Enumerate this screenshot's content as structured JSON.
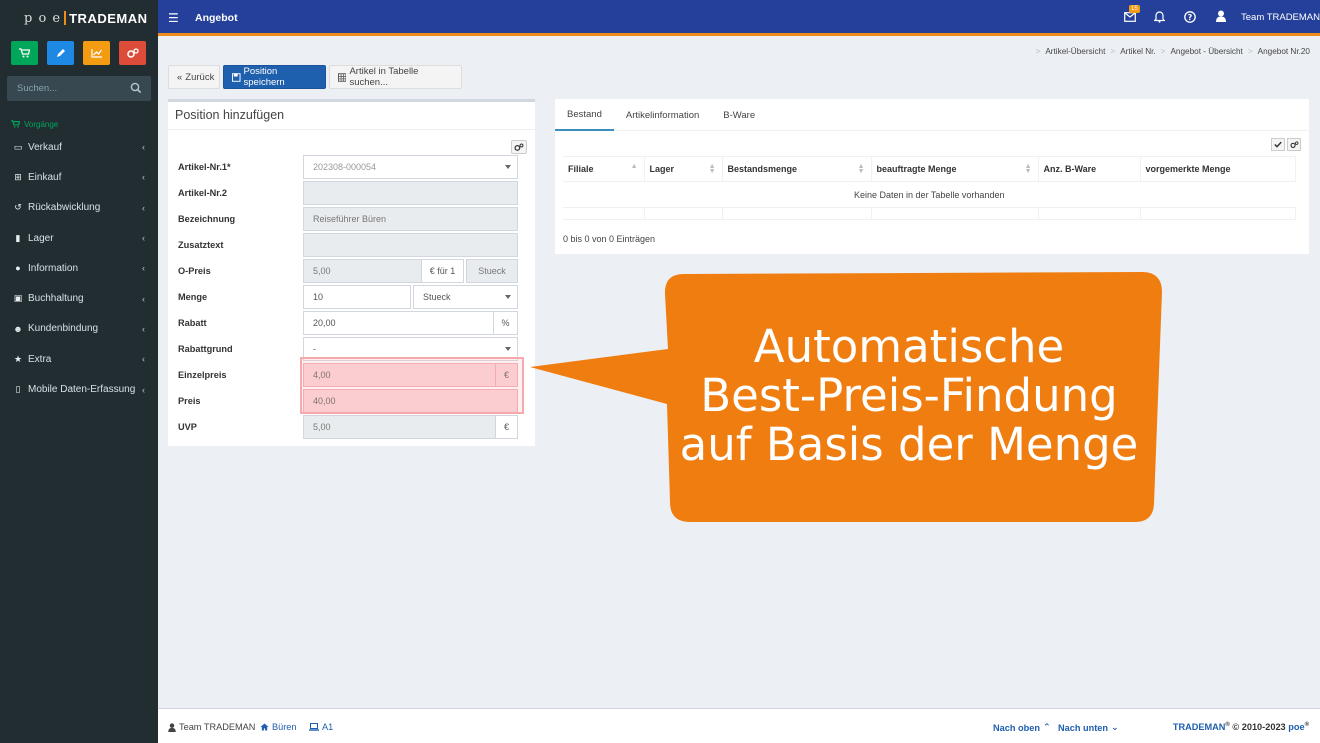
{
  "app": {
    "logo_prefix": "p o e",
    "logo_brand": "TRADEMAN",
    "page_title": "Angebot",
    "mail_count": "15",
    "user": "Team TRADEMAN"
  },
  "sidebar": {
    "search_placeholder": "Suchen...",
    "section": "Vorgänge",
    "items": [
      {
        "label": "Verkauf",
        "icon": "desktop-icon"
      },
      {
        "label": "Einkauf",
        "icon": "cart-icon"
      },
      {
        "label": "Rückabwicklung",
        "icon": "undo-icon"
      },
      {
        "label": "Lager",
        "icon": "truck-icon"
      },
      {
        "label": "Information",
        "icon": "info-icon"
      },
      {
        "label": "Buchhaltung",
        "icon": "money-icon"
      },
      {
        "label": "Kundenbindung",
        "icon": "users-icon"
      },
      {
        "label": "Extra",
        "icon": "star-icon"
      },
      {
        "label": "Mobile Daten-Erfassung",
        "icon": "mobile-icon"
      }
    ],
    "quick_colors": [
      "#00a65a",
      "#1e88e5",
      "#f39c12",
      "#dd4b39"
    ]
  },
  "breadcrumb": [
    "Artikel-Übersicht",
    "Artikel Nr.",
    "Angebot - Übersicht",
    "Angebot Nr.20"
  ],
  "toolbar": {
    "back": "Zurück",
    "save": "Position speichern",
    "search_table": "Artikel in Tabelle suchen..."
  },
  "form": {
    "title": "Position hinzufügen",
    "artikel_nr1_label": "Artikel-Nr.1*",
    "artikel_nr1_value": "202308-000054",
    "artikel_nr2_label": "Artikel-Nr.2",
    "artikel_nr2_value": "",
    "bezeichnung_label": "Bezeichnung",
    "bezeichnung_value": "Reiseführer Büren",
    "zusatztext_label": "Zusatztext",
    "zusatztext_value": "",
    "opreis_label": "O-Preis",
    "opreis_value": "5,00",
    "opreis_per": "€ für 1",
    "opreis_unit": "Stueck",
    "menge_label": "Menge",
    "menge_value": "10",
    "menge_unit": "Stueck",
    "rabatt_label": "Rabatt",
    "rabatt_value": "20,00",
    "rabatt_suffix": "%",
    "rabattgrund_label": "Rabattgrund",
    "rabattgrund_value": "-",
    "einzelpreis_label": "Einzelpreis",
    "einzelpreis_value": "4,00",
    "einzelpreis_suffix": "€",
    "preis_label": "Preis",
    "preis_value": "40,00",
    "uvp_label": "UVP",
    "uvp_value": "5,00",
    "uvp_suffix": "€"
  },
  "stock": {
    "tabs": [
      "Bestand",
      "Artikelinformation",
      "B-Ware"
    ],
    "columns": [
      "Filiale",
      "Lager",
      "Bestandsmenge",
      "beauftragte Menge",
      "Anz. B-Ware",
      "vorgemerkte Menge"
    ],
    "empty": "Keine Daten in der Tabelle vorhanden",
    "info": "0 bis 0 von 0 Einträgen"
  },
  "callout": {
    "line1": "Automatische",
    "line2": "Best-Preis-Findung",
    "line3": "auf Basis der Menge",
    "color": "#f07d10"
  },
  "footer": {
    "user": "Team TRADEMAN",
    "location": "Büren",
    "workstation": "A1",
    "up": "Nach oben",
    "down": "Nach unten",
    "brand": "TRADEMAN",
    "copyright": "© 2010-2023",
    "poe": "poe"
  }
}
